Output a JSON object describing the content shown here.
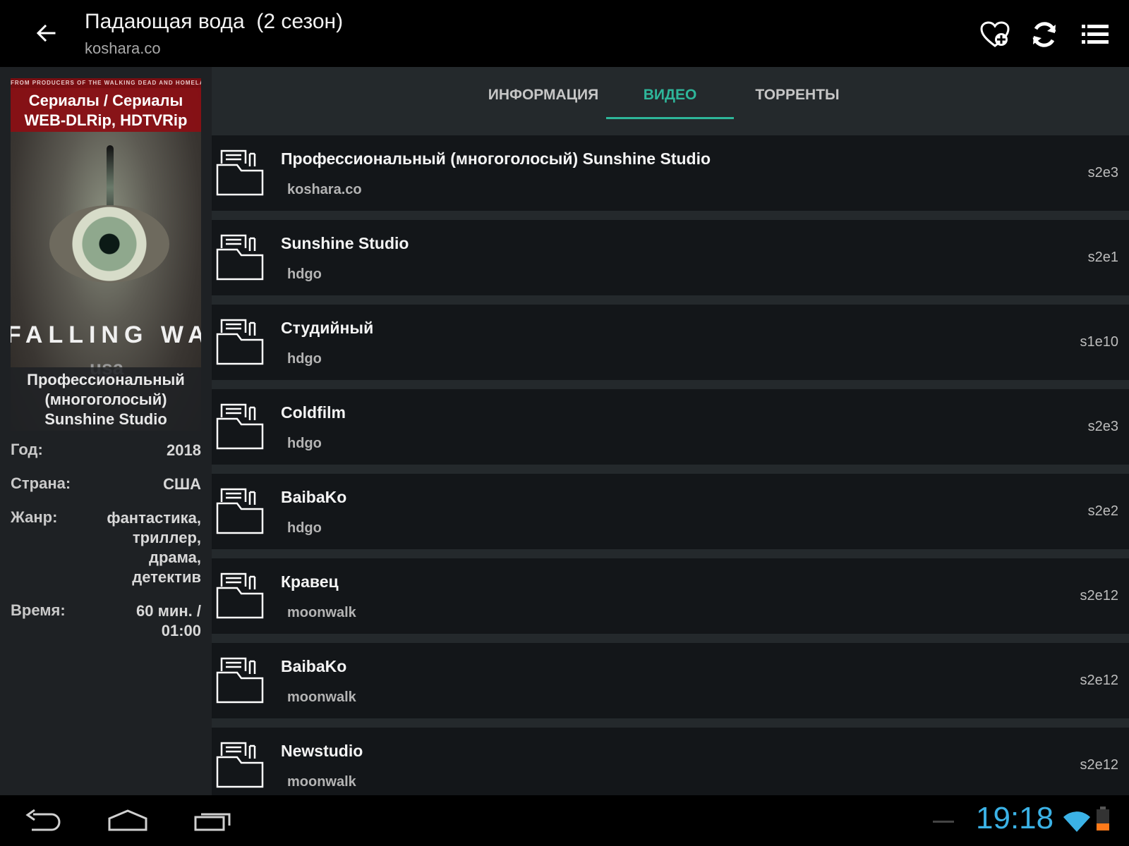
{
  "header": {
    "title": "Падающая вода  (2 сезон)",
    "subtitle": "koshara.co",
    "icons": [
      "back-arrow-icon",
      "favorite-add-icon",
      "refresh-icon",
      "menu-list-icon"
    ]
  },
  "poster": {
    "top_strip": "FROM PRODUCERS OF THE WALKING DEAD AND HOMELAND",
    "banner_line1": "Сериалы / Сериалы",
    "banner_line2": "WEB-DLRip, HDTVRip",
    "title_art": "FALLING WATER",
    "network": "usa",
    "caption_line1": "Профессиональный",
    "caption_line2": "(многоголосый)",
    "caption_line3": "Sunshine Studio"
  },
  "details": {
    "year_label": "Год:",
    "year_value": "2018",
    "country_label": "Страна:",
    "country_value": "США",
    "genre_label": "Жанр:",
    "genre_value": [
      "фантастика,",
      "триллер,",
      "драма,",
      "детектив"
    ],
    "time_label": "Время:",
    "time_value": [
      "60 мин. /",
      "01:00"
    ]
  },
  "tabs": [
    {
      "label": "ИНФОРМАЦИЯ",
      "active": false
    },
    {
      "label": "ВИДЕО",
      "active": true
    },
    {
      "label": "ТОРРЕНТЫ",
      "active": false
    }
  ],
  "accent_color": "#2eb69a",
  "videos": [
    {
      "name": "Профессиональный (многоголосый) Sunshine Studio",
      "source": "koshara.co",
      "episode": "s2e3"
    },
    {
      "name": "Sunshine Studio",
      "source": "hdgo",
      "episode": "s2e1"
    },
    {
      "name": "Студийный",
      "source": "hdgo",
      "episode": "s1e10"
    },
    {
      "name": "Coldfilm",
      "source": "hdgo",
      "episode": "s2e3"
    },
    {
      "name": "BaibaKo",
      "source": "hdgo",
      "episode": "s2e2"
    },
    {
      "name": "Кравец",
      "source": "moonwalk",
      "episode": "s2e12"
    },
    {
      "name": "BaibaKo",
      "source": "moonwalk",
      "episode": "s2e12"
    },
    {
      "name": "Newstudio",
      "source": "moonwalk",
      "episode": "s2e12"
    }
  ],
  "system_bar": {
    "time": "19:18",
    "icons": [
      "nav-back-icon",
      "nav-home-icon",
      "nav-recents-icon",
      "wifi-icon",
      "battery-icon"
    ]
  }
}
